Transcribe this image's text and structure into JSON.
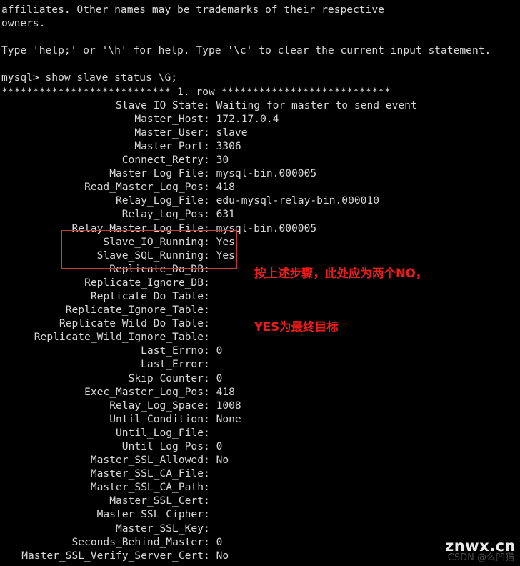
{
  "terminal": {
    "preamble": [
      "affiliates. Other names may be trademarks of their respective",
      "owners.",
      "",
      "Type 'help;' or '\\h' for help. Type '\\c' to clear the current input statement.",
      "",
      "mysql> show slave status \\G;"
    ],
    "row_separator": "*************************** 1. row ***************************",
    "prompt": "mysql>",
    "command": "show slave status \\G;",
    "status_fields": [
      {
        "name": "Slave_IO_State",
        "value": "Waiting for master to send event"
      },
      {
        "name": "Master_Host",
        "value": "172.17.0.4"
      },
      {
        "name": "Master_User",
        "value": "slave"
      },
      {
        "name": "Master_Port",
        "value": "3306"
      },
      {
        "name": "Connect_Retry",
        "value": "30"
      },
      {
        "name": "Master_Log_File",
        "value": "mysql-bin.000005"
      },
      {
        "name": "Read_Master_Log_Pos",
        "value": "418"
      },
      {
        "name": "Relay_Log_File",
        "value": "edu-mysql-relay-bin.000010"
      },
      {
        "name": "Relay_Log_Pos",
        "value": "631"
      },
      {
        "name": "Relay_Master_Log_File",
        "value": "mysql-bin.000005"
      },
      {
        "name": "Slave_IO_Running",
        "value": "Yes"
      },
      {
        "name": "Slave_SQL_Running",
        "value": "Yes"
      },
      {
        "name": "Replicate_Do_DB",
        "value": ""
      },
      {
        "name": "Replicate_Ignore_DB",
        "value": ""
      },
      {
        "name": "Replicate_Do_Table",
        "value": ""
      },
      {
        "name": "Replicate_Ignore_Table",
        "value": ""
      },
      {
        "name": "Replicate_Wild_Do_Table",
        "value": ""
      },
      {
        "name": "Replicate_Wild_Ignore_Table",
        "value": ""
      },
      {
        "name": "Last_Errno",
        "value": "0"
      },
      {
        "name": "Last_Error",
        "value": ""
      },
      {
        "name": "Skip_Counter",
        "value": "0"
      },
      {
        "name": "Exec_Master_Log_Pos",
        "value": "418"
      },
      {
        "name": "Relay_Log_Space",
        "value": "1008"
      },
      {
        "name": "Until_Condition",
        "value": "None"
      },
      {
        "name": "Until_Log_File",
        "value": ""
      },
      {
        "name": "Until_Log_Pos",
        "value": "0"
      },
      {
        "name": "Master_SSL_Allowed",
        "value": "No"
      },
      {
        "name": "Master_SSL_CA_File",
        "value": ""
      },
      {
        "name": "Master_SSL_CA_Path",
        "value": ""
      },
      {
        "name": "Master_SSL_Cert",
        "value": ""
      },
      {
        "name": "Master_SSL_Cipher",
        "value": ""
      },
      {
        "name": "Master_SSL_Key",
        "value": ""
      },
      {
        "name": "Seconds_Behind_Master",
        "value": "0"
      },
      {
        "name": "Master_SSL_Verify_Server_Cert",
        "value": "No"
      }
    ]
  },
  "annotation": {
    "line1": "按上述步骤，此处应为两个NO，",
    "line2": "YES为最终目标",
    "color": "#ee1b1b",
    "box_color": "#c43b3b",
    "highlighted_fields": [
      "Slave_IO_Running",
      "Slave_SQL_Running"
    ]
  },
  "watermark": {
    "site": "znwx.cn",
    "credit": "CSDN @么凹猫"
  },
  "colors": {
    "background": "#000000",
    "text": "#d8d8d8",
    "annotation_red": "#ee1b1b"
  }
}
